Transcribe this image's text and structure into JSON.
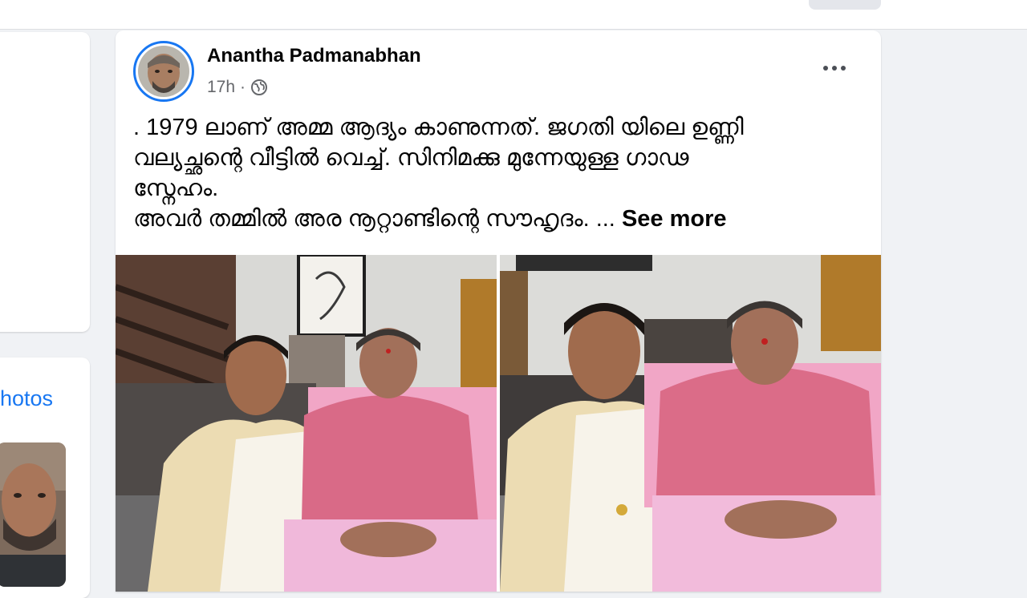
{
  "post": {
    "author": "Anantha Padmanabhan",
    "time": "17h",
    "separator": "·",
    "privacy_icon": "globe-icon",
    "more_icon": "more-options-icon",
    "text_lines": [
      ". 1979 ലാണ് അമ്മ ആദ്യം കാണുന്നത്. ജഗതി യിലെ ഉണ്ണി",
      "വല്യച്ഛന്റെ വീട്ടിൽ വെച്ച്. സിനിമക്കു മുന്നേയുള്ള ഗാഢ",
      "സ്നേഹം.",
      "അവർ തമ്മിൽ അര നൂറ്റാണ്ടിന്റെ സൗഹൃദം. ..."
    ],
    "see_more": "See more"
  },
  "sidebar": {
    "photos_label": "hotos"
  },
  "colors": {
    "accent": "#1877f2",
    "background": "#f0f2f5",
    "card": "#ffffff",
    "secondary_text": "#65676b"
  }
}
